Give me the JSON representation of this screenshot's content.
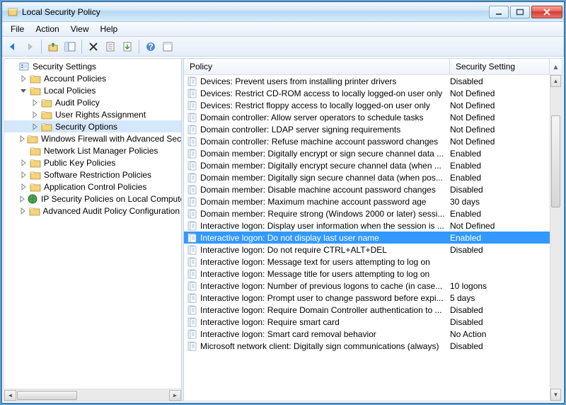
{
  "window": {
    "title": "Local Security Policy"
  },
  "menu": {
    "file": "File",
    "action": "Action",
    "view": "View",
    "help": "Help"
  },
  "tree": {
    "root": "Security Settings",
    "nodes": [
      {
        "label": "Account Policies",
        "expanded": false,
        "children": true,
        "indent": 1,
        "icon": "folder"
      },
      {
        "label": "Local Policies",
        "expanded": true,
        "children": true,
        "indent": 1,
        "icon": "folder"
      },
      {
        "label": "Audit Policy",
        "expanded": false,
        "children": true,
        "indent": 2,
        "icon": "folder"
      },
      {
        "label": "User Rights Assignment",
        "expanded": false,
        "children": true,
        "indent": 2,
        "icon": "folder"
      },
      {
        "label": "Security Options",
        "expanded": false,
        "children": true,
        "indent": 2,
        "icon": "folder",
        "selected": true
      },
      {
        "label": "Windows Firewall with Advanced Secu",
        "expanded": false,
        "children": true,
        "indent": 1,
        "icon": "folder"
      },
      {
        "label": "Network List Manager Policies",
        "expanded": false,
        "children": false,
        "indent": 1,
        "icon": "folder"
      },
      {
        "label": "Public Key Policies",
        "expanded": false,
        "children": true,
        "indent": 1,
        "icon": "folder"
      },
      {
        "label": "Software Restriction Policies",
        "expanded": false,
        "children": true,
        "indent": 1,
        "icon": "folder"
      },
      {
        "label": "Application Control Policies",
        "expanded": false,
        "children": true,
        "indent": 1,
        "icon": "folder"
      },
      {
        "label": "IP Security Policies on Local Compute",
        "expanded": false,
        "children": true,
        "indent": 1,
        "icon": "ipsec"
      },
      {
        "label": "Advanced Audit Policy Configuration",
        "expanded": false,
        "children": true,
        "indent": 1,
        "icon": "folder"
      }
    ]
  },
  "list": {
    "columns": {
      "policy": "Policy",
      "setting": "Security Setting"
    },
    "rows": [
      {
        "policy": "Devices: Prevent users from installing printer drivers",
        "setting": "Disabled"
      },
      {
        "policy": "Devices: Restrict CD-ROM access to locally logged-on user only",
        "setting": "Not Defined"
      },
      {
        "policy": "Devices: Restrict floppy access to locally logged-on user only",
        "setting": "Not Defined"
      },
      {
        "policy": "Domain controller: Allow server operators to schedule tasks",
        "setting": "Not Defined"
      },
      {
        "policy": "Domain controller: LDAP server signing requirements",
        "setting": "Not Defined"
      },
      {
        "policy": "Domain controller: Refuse machine account password changes",
        "setting": "Not Defined"
      },
      {
        "policy": "Domain member: Digitally encrypt or sign secure channel data ...",
        "setting": "Enabled"
      },
      {
        "policy": "Domain member: Digitally encrypt secure channel data (when ...",
        "setting": "Enabled"
      },
      {
        "policy": "Domain member: Digitally sign secure channel data (when pos...",
        "setting": "Enabled"
      },
      {
        "policy": "Domain member: Disable machine account password changes",
        "setting": "Disabled"
      },
      {
        "policy": "Domain member: Maximum machine account password age",
        "setting": "30 days"
      },
      {
        "policy": "Domain member: Require strong (Windows 2000 or later) sessi...",
        "setting": "Enabled"
      },
      {
        "policy": "Interactive logon: Display user information when the session is ...",
        "setting": "Not Defined"
      },
      {
        "policy": "Interactive logon: Do not display last user name",
        "setting": "Enabled",
        "selected": true
      },
      {
        "policy": "Interactive logon: Do not require CTRL+ALT+DEL",
        "setting": "Disabled"
      },
      {
        "policy": "Interactive logon: Message text for users attempting to log on",
        "setting": ""
      },
      {
        "policy": "Interactive logon: Message title for users attempting to log on",
        "setting": ""
      },
      {
        "policy": "Interactive logon: Number of previous logons to cache (in case...",
        "setting": "10 logons"
      },
      {
        "policy": "Interactive logon: Prompt user to change password before expi...",
        "setting": "5 days"
      },
      {
        "policy": "Interactive logon: Require Domain Controller authentication to ...",
        "setting": "Disabled"
      },
      {
        "policy": "Interactive logon: Require smart card",
        "setting": "Disabled"
      },
      {
        "policy": "Interactive logon: Smart card removal behavior",
        "setting": "No Action"
      },
      {
        "policy": "Microsoft network client: Digitally sign communications (always)",
        "setting": "Disabled"
      }
    ]
  }
}
